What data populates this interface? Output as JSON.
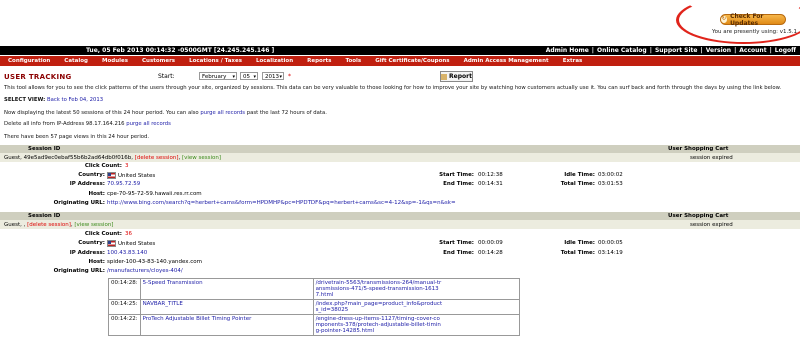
{
  "header": {
    "update_button": "Check For Updates",
    "version_text": "You are presently using: v1.5.1",
    "datetime": "Tue, 05 Feb 2013 00:14:32 -0500GMT [24.245.245.146 ]",
    "top_links": [
      "Admin Home",
      "Online Catalog",
      "Support Site",
      "Version",
      "Account",
      "Logoff"
    ]
  },
  "menu": [
    "Configuration",
    "Catalog",
    "Modules",
    "Customers",
    "Locations / Taxes",
    "Localization",
    "Reports",
    "Tools",
    "Gift Certificate/Coupons",
    "Admin Access Management",
    "Extras"
  ],
  "page": {
    "title": "USER TRACKING",
    "start_label": "Start:",
    "month": "February",
    "day": "05",
    "year": "2013",
    "required_mark": "*",
    "report_button": "Report",
    "description": "This tool allows for you to see the click patterns of the users through your site, organized by sessions. This data can be very valuable to those looking for how to improve your site by watching how customers actually use it. You can surf back and forth through the days by using the link below.",
    "select_view_label": "SELECT VIEW:",
    "select_view_link": "Back to Feb 04, 2013",
    "displaying_text": "Now displaying the latest 50 sessions of this 24 hour period. You can also",
    "purge_all_link": "purge all records",
    "displaying_text_after": "past the last 72 hours of data.",
    "delete_text": "Delete all info from IP-Address 98.17.164.216",
    "purge_link": "purge all records",
    "page_views": "There have been 57 page views in this 24 hour period."
  },
  "labels": {
    "session_id": "Session ID",
    "cart": "User Shopping Cart",
    "click_count": "Click Count:",
    "country": "Country:",
    "ip_address": "IP Address:",
    "host": "Host:",
    "originating_url": "Originating URL:",
    "start_time": "Start Time:",
    "end_time": "End Time:",
    "idle_time": "Idle Time:",
    "total_time": "Total Time:",
    "delete_session": "[delete session]",
    "view_session": "[view session]"
  },
  "sessions": [
    {
      "guest": "Guest, 49e5ad9ec0ebaf55b6b2ad64db0f016b,",
      "cart": "session expired",
      "click_count": "3",
      "country": "United States",
      "ip": "70.95.72.59",
      "host": "cpe-70-95-72-59.hawaii.res.rr.com",
      "url": "http://www.bing.com/search?q=herbert+cams&form=HPDMHP&pc=HPDTDF&pq=herbert+cams&sc=4-12&sp=-1&qs=n&sk=",
      "start": "00:12:38",
      "end": "00:14:31",
      "idle": "03:00:02",
      "total": "03:01:53"
    },
    {
      "guest": "Guest, ,",
      "cart": "session expired",
      "click_count": "36",
      "country": "United States",
      "ip": "100.43.83.140",
      "host": "spider-100-43-83-140.yandex.com",
      "url": "/manufacturers/cloyes-404/",
      "start": "00:00:09",
      "end": "00:14:28",
      "idle": "00:00:05",
      "total": "03:14:19"
    }
  ],
  "url_rows": [
    {
      "time": "00:14:28:",
      "name": "5-Speed Transmission",
      "url": "/drivetrain-5563/transmissions-264/manual-transmissions-471/5-speed-transmission-16137.html"
    },
    {
      "time": "00:14:25:",
      "name": "NAVBAR_TITLE",
      "url": "/index.php?main_page=product_info&products_id=38025"
    },
    {
      "time": "00:14:22:",
      "name": "ProTech Adjustable Billet Timing Pointer",
      "url": "/engine-dress-up-items-1127/timing-cover-components-378/protech-adjustable-billet-timing-pointer-14285.html"
    }
  ],
  "colors": {
    "menu_bar": "#c01f0f",
    "top_bar": "#000000",
    "title": "#8b0000",
    "section_header": "#cfcfbf",
    "link": "#1a1aa6"
  }
}
